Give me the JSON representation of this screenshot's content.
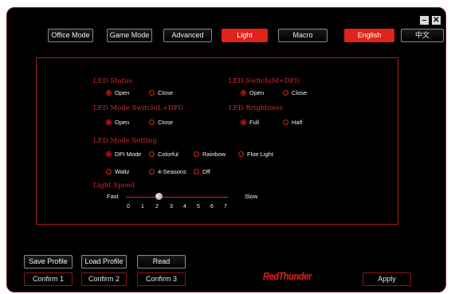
{
  "window_controls": {
    "minimize": "–",
    "close": "✕"
  },
  "top_tabs": [
    {
      "label": "Office Mode"
    },
    {
      "label": "Game Mode"
    },
    {
      "label": "Advanced"
    },
    {
      "label": "Light"
    },
    {
      "label": "Macro"
    }
  ],
  "languages": [
    {
      "label": "English"
    },
    {
      "label": "中文"
    }
  ],
  "led_status": {
    "title": "LED Status",
    "options": [
      "Open",
      "Close"
    ],
    "selected": "Open"
  },
  "led_switch": {
    "title": "LED Switch(M+DPI)",
    "options": [
      "Open",
      "Close"
    ],
    "selected": "Open"
  },
  "led_mode_switch": {
    "title": "LED Mode Switch(L+DPI)",
    "options": [
      "Open",
      "Close"
    ],
    "selected": "Open"
  },
  "led_brightness": {
    "title": "LED Brightness",
    "options": [
      "Full",
      "Half"
    ],
    "selected": "Full"
  },
  "led_mode_setting": {
    "title": "LED Mode Setting",
    "options": [
      "DPI Mode",
      "Colorful",
      "Rainbow",
      "Floe Light",
      "Waltz",
      "4-Seasons",
      "Off"
    ],
    "selected": "DPI Mode"
  },
  "light_speed": {
    "title": "Light Speed",
    "fast_label": "Fast",
    "slow_label": "Slow",
    "ticks": [
      "0",
      "1",
      "2",
      "3",
      "4",
      "5",
      "6",
      "7"
    ],
    "value": 2
  },
  "bottom": {
    "save_profile": "Save Profile",
    "load_profile": "Load Profile",
    "read": "Read",
    "confirm1": "Confirm 1",
    "confirm2": "Confirm 2",
    "confirm3": "Confirm 3",
    "apply": "Apply",
    "logo": "RedThunder"
  },
  "colors": {
    "accent": "#e2231a",
    "heading": "#d42a2a",
    "background": "#000000"
  }
}
